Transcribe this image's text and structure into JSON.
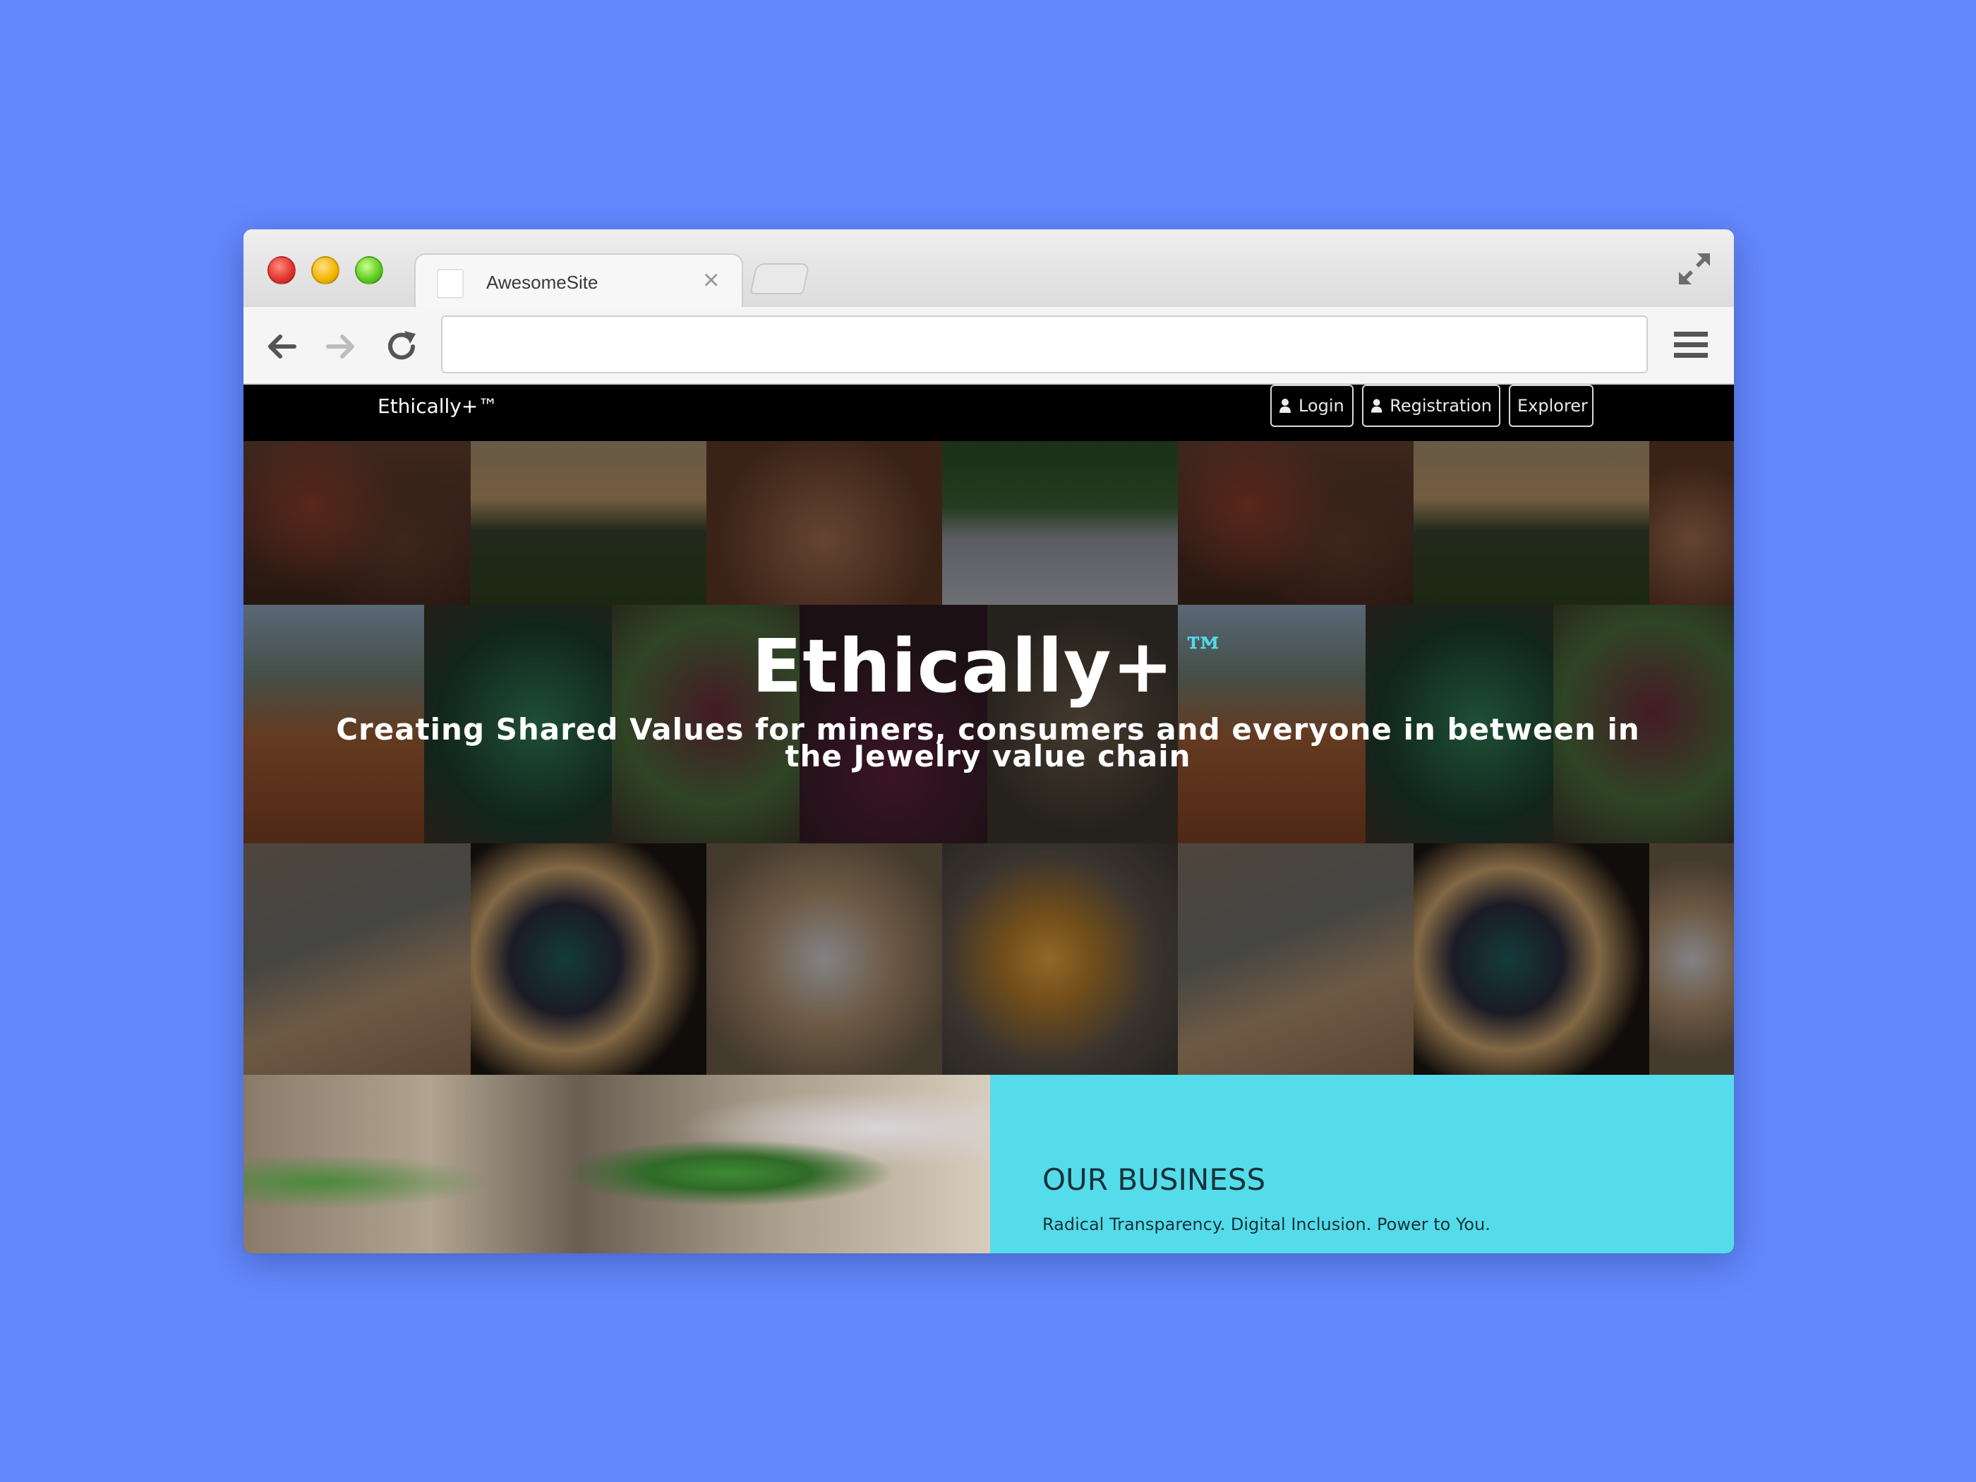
{
  "browser": {
    "tab_title": "AwesomeSite",
    "url": ""
  },
  "site": {
    "brand": "Ethically+™",
    "nav": {
      "login": "Login",
      "registration": "Registration",
      "explorer": "Explorer"
    },
    "hero": {
      "title": "Ethically+",
      "title_mark": "™",
      "subtitle": "Creating Shared Values for miners, consumers and everyone in between in the Jewelry value chain"
    },
    "business": {
      "title": "OUR BUSINESS",
      "tagline": "Radical Transparency. Digital Inclusion. Power to You."
    }
  },
  "colors": {
    "desktop": "#6388fd",
    "accent": "#55dcea",
    "nav_background": "#000000"
  }
}
